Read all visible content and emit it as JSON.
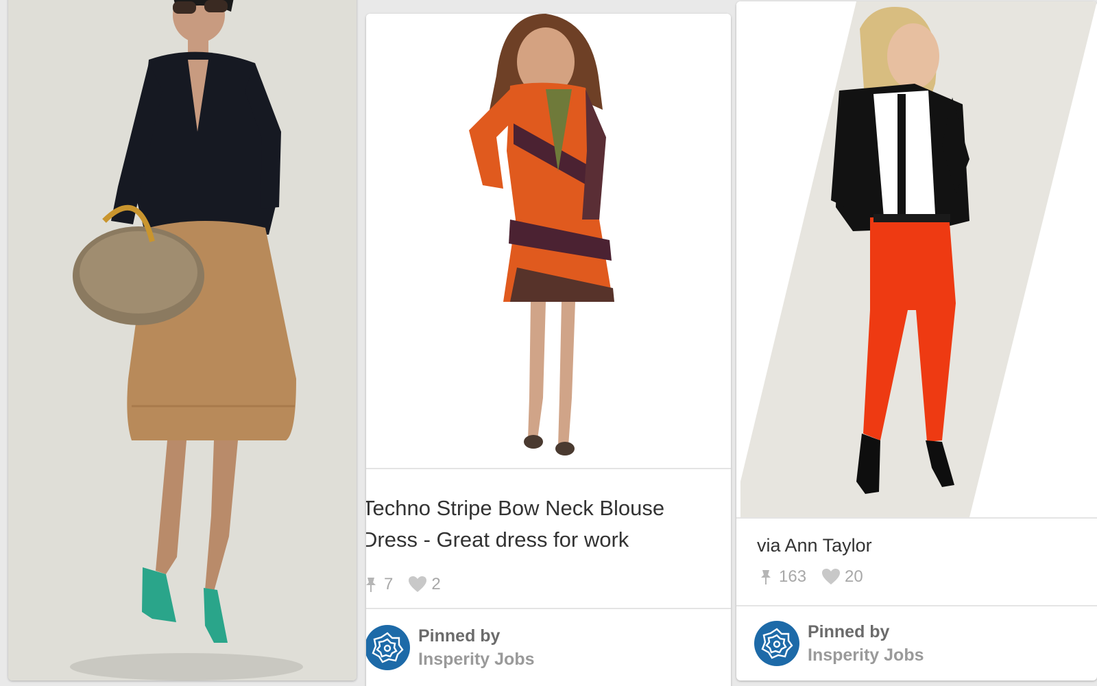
{
  "pins": [
    {
      "image_alt": "woman in black cardigan, camel skirt, holding woven bag",
      "colors": {
        "background": "#deddd6",
        "cardigan": "#151820",
        "skirt": "#b8895a",
        "shoes": "#2aa58a"
      }
    },
    {
      "image_alt": "woman in patterned long-sleeve dress",
      "description_line1": "Techno Stripe Bow Neck Blouse",
      "description_line2": "Dress - Great dress for work",
      "repins": "7",
      "likes": "2",
      "pinned_by_label": "Pinned by",
      "pinner_name": "Insperity Jobs",
      "colors": {
        "dress_orange": "#e05a1e",
        "dress_plum": "#4b2232"
      }
    },
    {
      "image_alt": "woman in black blazer and red skinny pants",
      "description": "via Ann Taylor",
      "repins": "163",
      "likes": "20",
      "pinned_by_label": "Pinned by",
      "pinner_name": "Insperity Jobs",
      "colors": {
        "pants": "#ee3a12",
        "blazer": "#121212"
      }
    }
  ],
  "icons": {
    "repin": "pushpin-icon",
    "like": "heart-icon",
    "avatar": "insperity-logo-icon"
  },
  "accent": "#1d6aa8"
}
